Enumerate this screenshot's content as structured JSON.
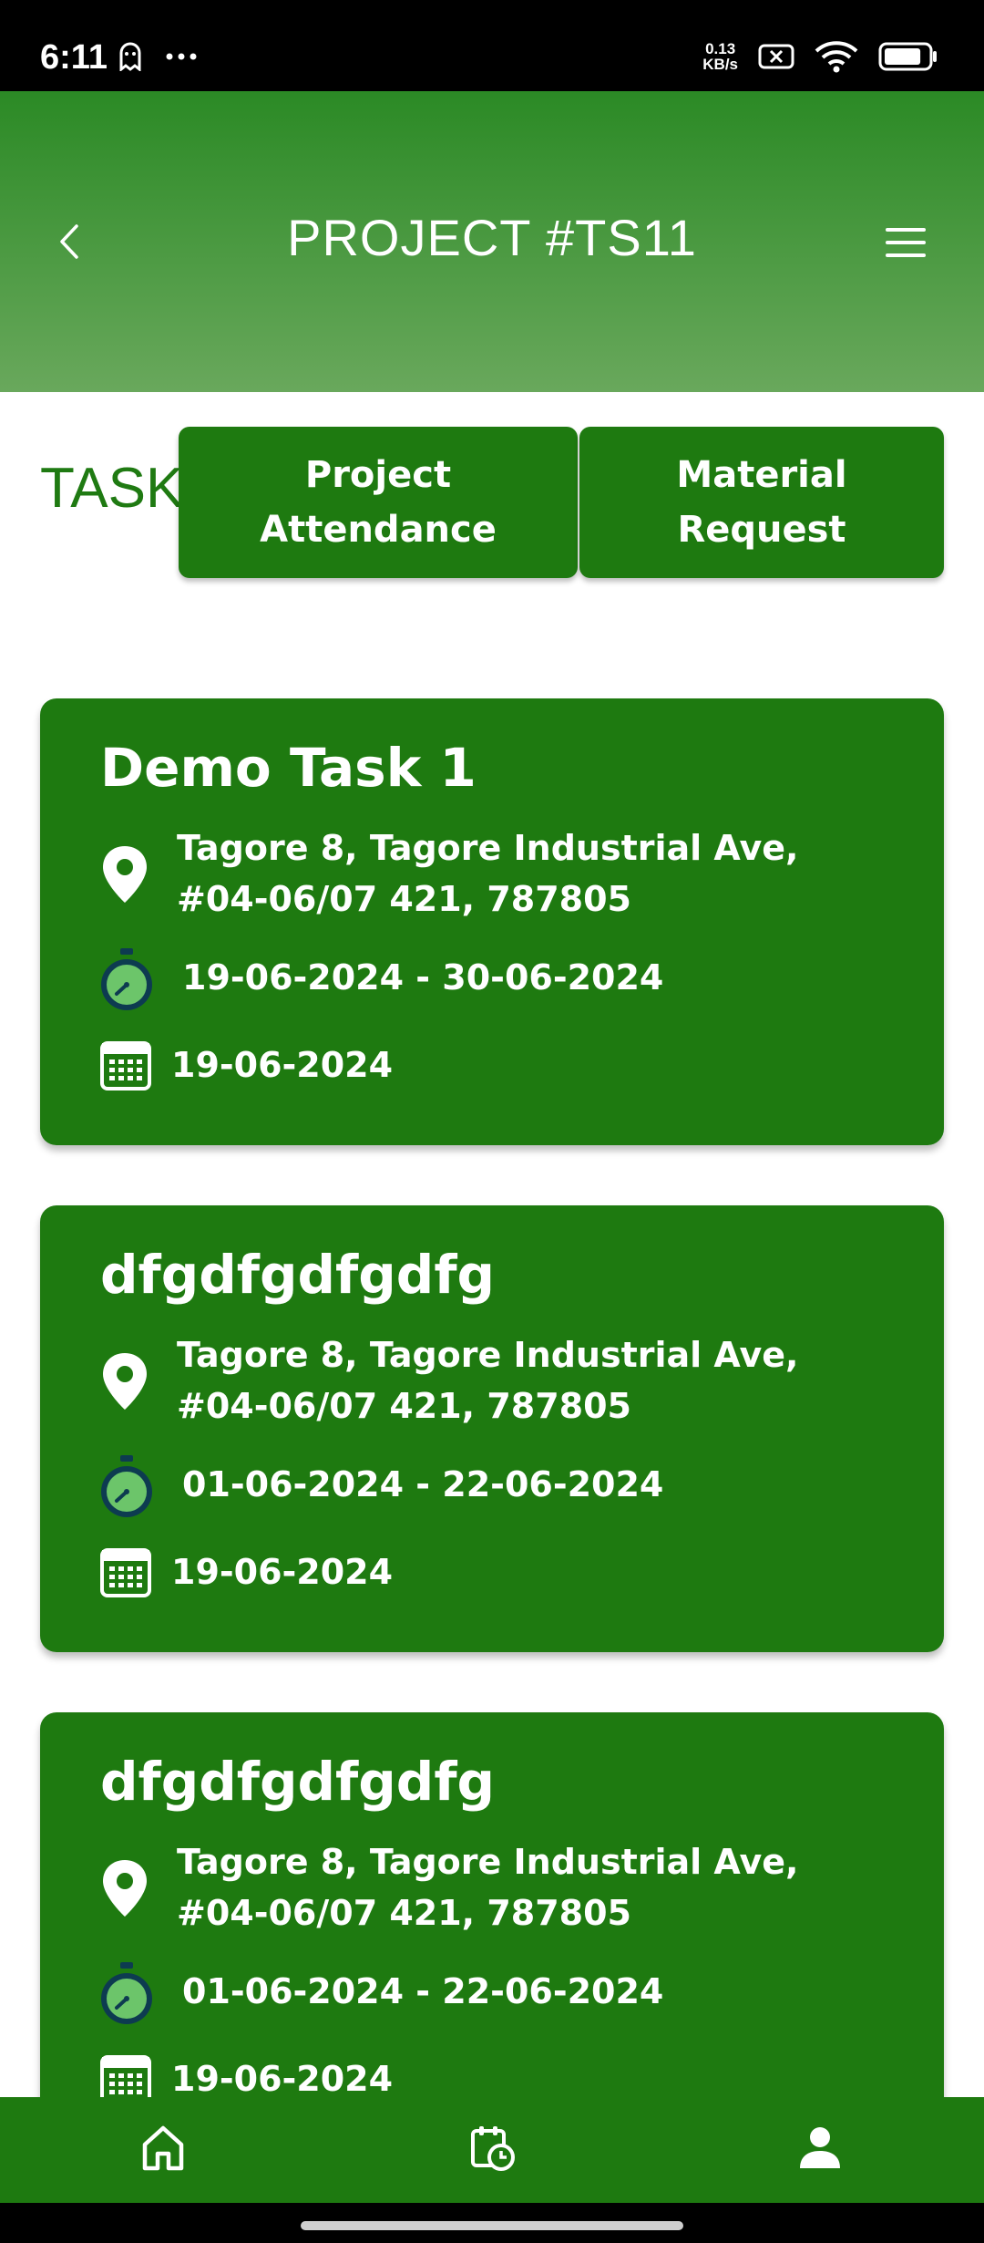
{
  "status_bar": {
    "time": "6:11",
    "net_speed_value": "0.13",
    "net_speed_unit": "KB/s",
    "battery_level": 0.85
  },
  "header": {
    "title": "PROJECT #TS11",
    "back_icon": "chevron-left-icon",
    "menu_icon": "hamburger-menu-icon"
  },
  "tabs": {
    "task_label": "TASK",
    "attendance_line1": "Project",
    "attendance_line2": "Attendance",
    "material_line1": "Material",
    "material_line2": "Request"
  },
  "tasks": [
    {
      "title": "Demo Task 1",
      "address": "Tagore 8, Tagore Industrial Ave, #04-06/07 421, 787805",
      "date_range": "19-06-2024 - 30-06-2024",
      "date": "19-06-2024"
    },
    {
      "title": "dfgdfgdfgdfg",
      "address": "Tagore 8, Tagore Industrial Ave, #04-06/07 421, 787805",
      "date_range": "01-06-2024 - 22-06-2024",
      "date": "19-06-2024"
    },
    {
      "title": "dfgdfgdfgdfg",
      "address": "Tagore 8, Tagore Industrial Ave, #04-06/07 421, 787805",
      "date_range": "01-06-2024 - 22-06-2024",
      "date": "19-06-2024"
    }
  ],
  "bottom_nav": {
    "items": [
      "home-icon",
      "attendance-clock-icon",
      "profile-icon"
    ]
  },
  "colors": {
    "primary": "#1e7a10",
    "header_top": "#2b8a25",
    "header_bottom": "#69a85c"
  }
}
